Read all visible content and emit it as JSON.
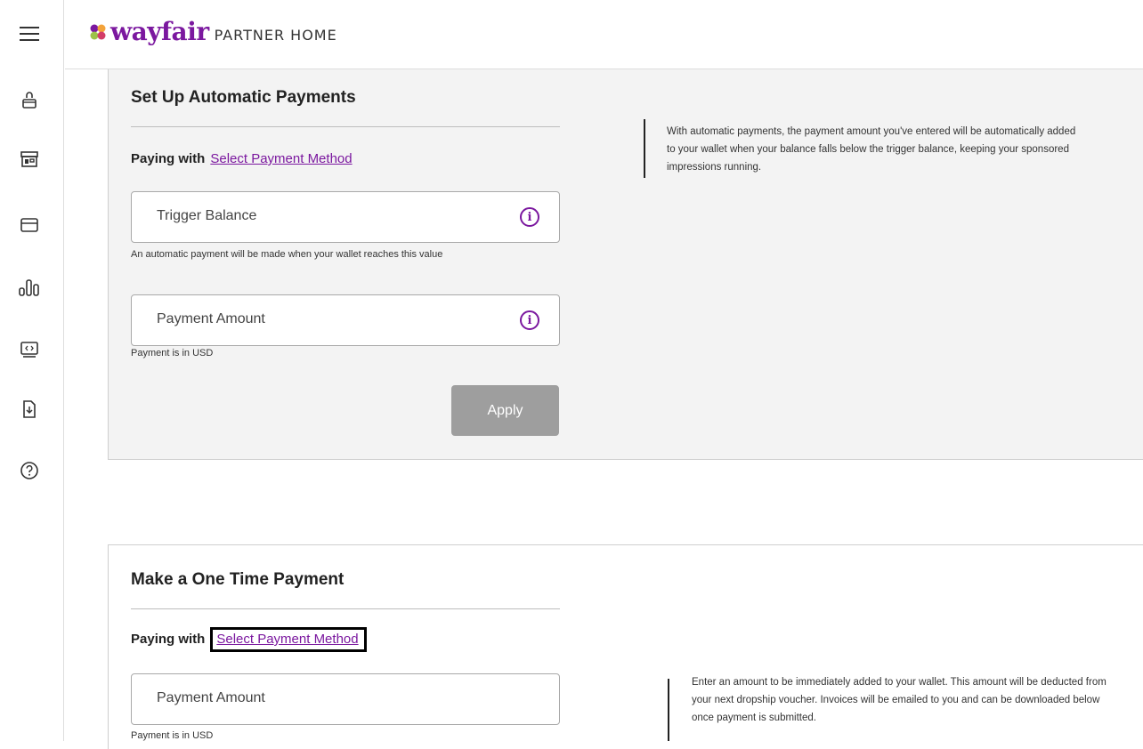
{
  "header": {
    "logo_word": "wayfair",
    "logo_sub": "PARTNER HOME"
  },
  "sidebar": {
    "icons": [
      "menu-icon",
      "bag-icon",
      "storefront-icon",
      "credit-card-icon",
      "bar-chart-icon",
      "monitor-code-icon",
      "document-download-icon",
      "help-icon"
    ]
  },
  "auto_payments": {
    "title": "Set Up Automatic Payments",
    "paying_with_label": "Paying with",
    "select_method_link": "Select Payment Method",
    "trigger_field_label": "Trigger Balance",
    "trigger_help": "An automatic payment will be made when your wallet reaches this value",
    "amount_field_label": "Payment Amount",
    "amount_help": "Payment is in USD",
    "apply_label": "Apply",
    "note": "With automatic payments, the payment amount you've entered will be automatically added to your wallet when your balance falls below the trigger balance, keeping your sponsored impressions running."
  },
  "one_time": {
    "title": "Make a One Time Payment",
    "paying_with_label": "Paying with",
    "select_method_link": "Select Payment Method",
    "amount_field_label": "Payment Amount",
    "amount_help": "Payment is in USD",
    "note": "Enter an amount to be immediately added to your wallet. This amount will be deducted from your next dropship voucher. Invoices will be emailed to you and can be downloaded below once payment is submitted."
  },
  "colors": {
    "brand": "#7b189f",
    "button_disabled": "#9e9e9e"
  }
}
